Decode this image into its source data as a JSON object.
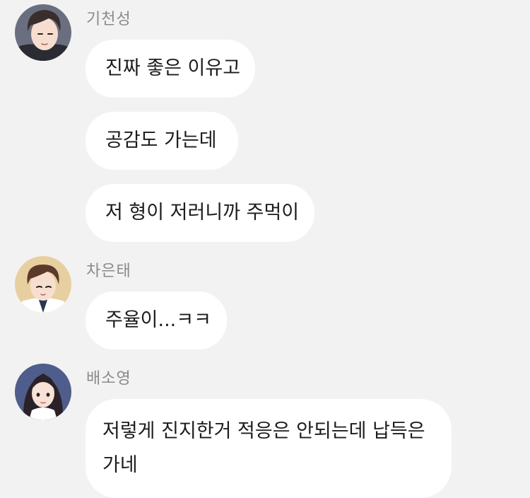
{
  "messages": [
    {
      "sender": "기천성",
      "avatar_icon": "character-avatar-dark-haired-man-icon",
      "bubbles": [
        "진짜 좋은 이유고",
        "공감도 가는데",
        "저 형이 저러니까 주먹이"
      ]
    },
    {
      "sender": "차은태",
      "avatar_icon": "character-avatar-brown-haired-man-icon",
      "bubbles": [
        "주율이...ㅋㅋ"
      ]
    },
    {
      "sender": "배소영",
      "avatar_icon": "character-avatar-long-haired-woman-icon",
      "bubbles": [
        [
          "저렇게 진지한거 적응은 안되는데 납득은",
          "가네"
        ]
      ]
    }
  ],
  "colors": {
    "background": "#f2f2f2",
    "bubble": "#ffffff",
    "sender_text": "#8a8a8a",
    "message_text": "#1c1c1c"
  }
}
